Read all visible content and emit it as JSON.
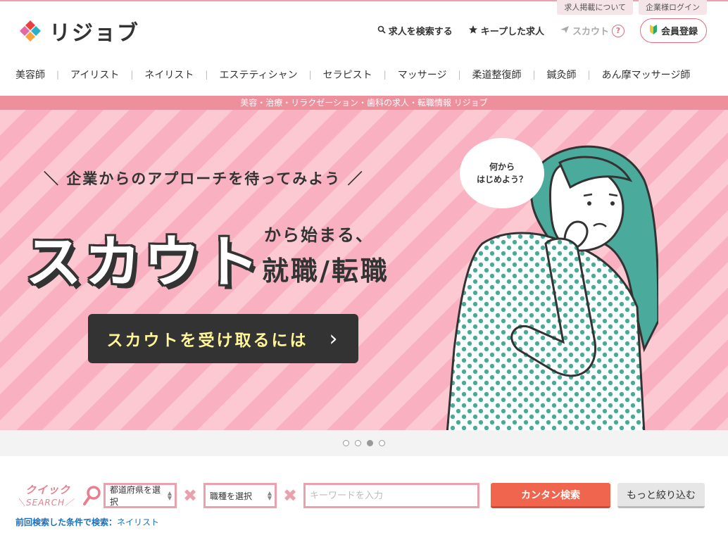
{
  "util_links": [
    "求人掲載について",
    "企業様ログイン"
  ],
  "logo": {
    "text": "リジョブ"
  },
  "header": {
    "search_jobs": "求人を検索する",
    "kept_jobs": "キープした求人",
    "scout": "スカウト",
    "help": "?",
    "register": "会員登録"
  },
  "nav": [
    "美容師",
    "アイリスト",
    "ネイリスト",
    "エステティシャン",
    "セラピスト",
    "マッサージ",
    "柔道整復師",
    "鍼灸師",
    "あん摩マッサージ師"
  ],
  "strip_text": "美容・治療・リラクゼーション・歯科の求人・転職情報 リジョブ",
  "hero": {
    "tagline": "＼ 企業からのアプローチを待ってみよう ／",
    "big": "スカウト",
    "sub1": "から始まる、",
    "sub2": "就職/転職",
    "cta": "スカウトを受け取るには",
    "cta_arrow": "›",
    "bubble_line1": "何から",
    "bubble_line2": "はじめよう？"
  },
  "carousel": {
    "count": 4,
    "active_index": 2
  },
  "quick_search": {
    "label_top": "クイック",
    "label_bottom": "＼SEARCH／",
    "prefecture": "都道府県を選択",
    "job_type": "職種を選択",
    "keyword_placeholder": "キーワードを入力",
    "search_button": "カンタン検索",
    "more_button": "もっと絞り込む"
  },
  "prev_search": {
    "label": "前回検索した条件で検索：",
    "value": "ネイリスト"
  },
  "colors": {
    "accent_pink": "#e56b7c",
    "strip": "#ee8f9c",
    "cta_bg": "#333333",
    "search_btn": "#f0654e",
    "teal_hair": "#4aab9c"
  }
}
